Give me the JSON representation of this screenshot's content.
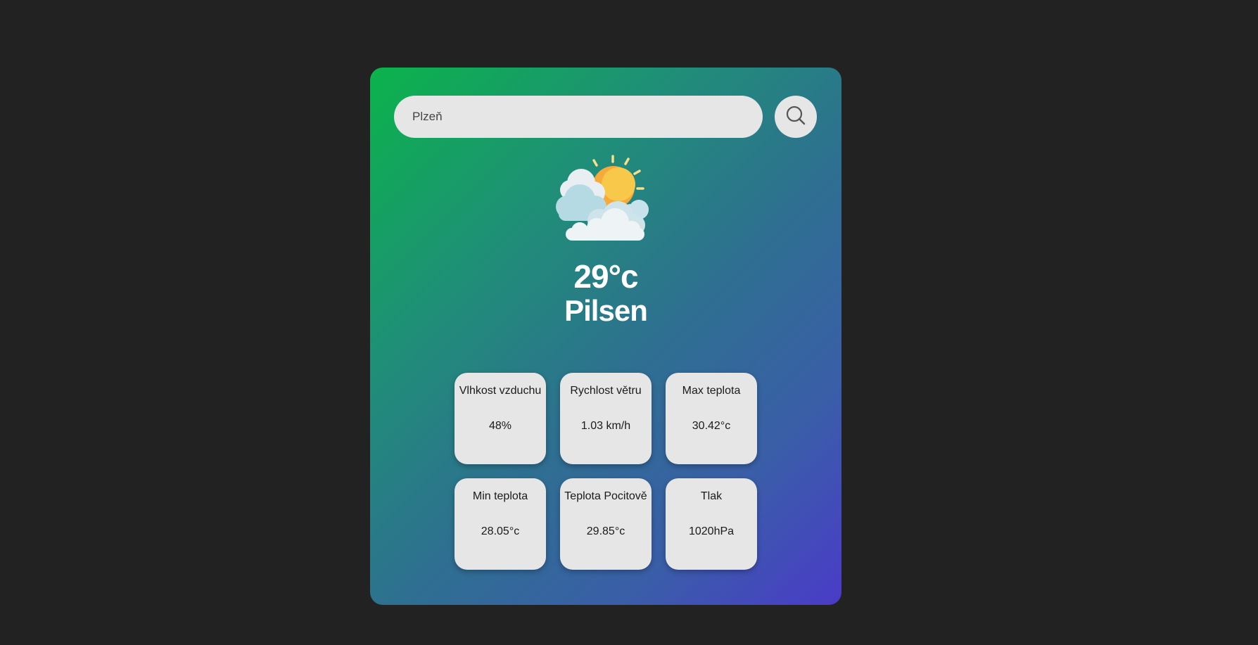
{
  "search": {
    "value": "Plzeň"
  },
  "icons": {
    "search": "search-icon",
    "weather": "partly-cloudy-sun-icon"
  },
  "weather": {
    "temperature": "29°c",
    "city": "Pilsen"
  },
  "details": [
    {
      "label": "Vlhkost vzduchu",
      "value": "48%"
    },
    {
      "label": "Rychlost větru",
      "value": "1.03 km/h"
    },
    {
      "label": "Max teplota",
      "value": "30.42°c"
    },
    {
      "label": "Min teplota",
      "value": "28.05°c"
    },
    {
      "label": "Teplota Pocitově",
      "value": "29.85°c"
    },
    {
      "label": "Tlak",
      "value": "1020hPa"
    }
  ],
  "colors": {
    "page_background": "#222222",
    "gradient_start": "#0bb34b",
    "gradient_end": "#4a3bc8",
    "tile_background": "#e6e6e6",
    "text_light": "#ffffff"
  }
}
